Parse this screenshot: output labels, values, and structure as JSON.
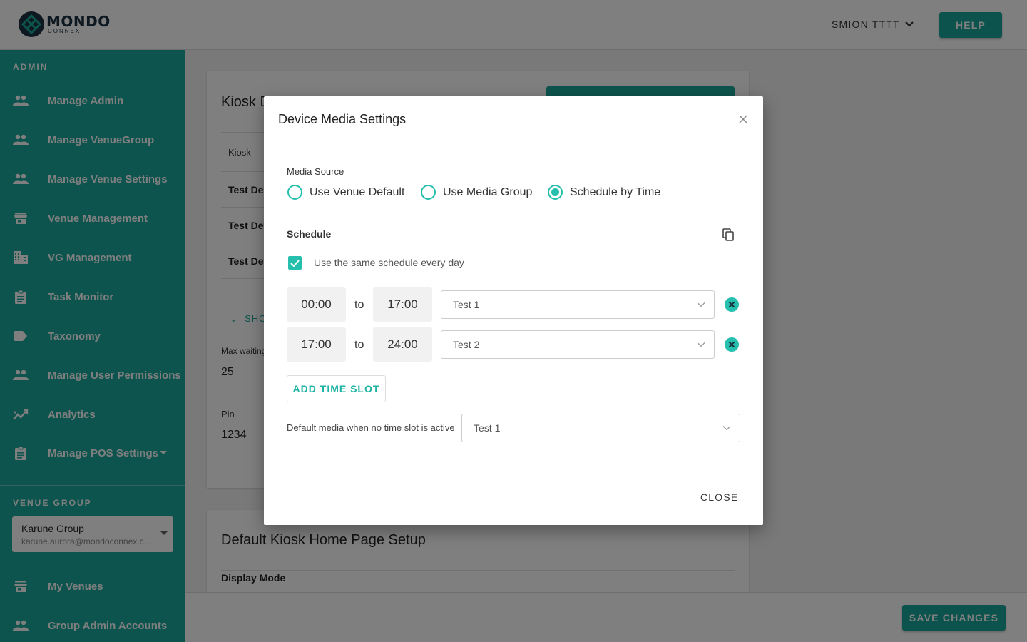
{
  "brand": {
    "name": "MONDO",
    "sub": "CONNEX",
    "accent": "#1aa79a"
  },
  "header": {
    "user_name": "SMION TTTT",
    "help_label": "HELP"
  },
  "sidebar": {
    "admin_title": "ADMIN",
    "items": [
      {
        "label": "Manage Admin",
        "icon": "people-icon"
      },
      {
        "label": "Manage VenueGroup",
        "icon": "people-icon"
      },
      {
        "label": "Manage Venue Settings",
        "icon": "people-icon"
      },
      {
        "label": "Venue Management",
        "icon": "store-icon"
      },
      {
        "label": "VG Management",
        "icon": "building-icon"
      },
      {
        "label": "Task Monitor",
        "icon": "clipboard-icon"
      },
      {
        "label": "Taxonomy",
        "icon": "tag-icon"
      },
      {
        "label": "Manage User Permissions",
        "icon": "people-icon"
      },
      {
        "label": "Analytics",
        "icon": "trending-icon"
      },
      {
        "label": "Manage POS Settings",
        "icon": "clipboard-icon"
      }
    ],
    "venue_group_title": "VENUE GROUP",
    "venue_group": {
      "name": "Karune Group",
      "email": "karune.aurora@mondoconnex.com"
    },
    "bottom_items": [
      {
        "label": "My Venues",
        "icon": "store-icon"
      },
      {
        "label": "Group Admin Accounts",
        "icon": "people-icon"
      }
    ]
  },
  "background": {
    "card_title": "Kiosk D",
    "col_kiosk": "Kiosk",
    "rows": [
      "Test Dev",
      "Test Dev",
      "Test Dev"
    ],
    "show_more": "SHO",
    "max_waiting_label": "Max waiting",
    "max_waiting_value": "25",
    "pin_label": "Pin",
    "pin_value": "1234",
    "home_title": "Default Kiosk Home Page Setup",
    "display_mode_label": "Display Mode",
    "save_label": "SAVE CHANGES"
  },
  "modal": {
    "title": "Device Media Settings",
    "media_source_label": "Media Source",
    "radios": [
      {
        "label": "Use Venue Default",
        "checked": false
      },
      {
        "label": "Use Media Group",
        "checked": false
      },
      {
        "label": "Schedule by Time",
        "checked": true
      }
    ],
    "schedule_label": "Schedule",
    "same_schedule_label": "Use the same schedule every day",
    "same_schedule_checked": true,
    "to_label": "to",
    "slots": [
      {
        "start": "00:00",
        "end": "17:00",
        "media": "Test 1"
      },
      {
        "start": "17:00",
        "end": "24:00",
        "media": "Test 2"
      }
    ],
    "add_slot_label": "ADD TIME SLOT",
    "default_media_label": "Default media when no time slot is active",
    "default_media_value": "Test 1",
    "close_label": "CLOSE"
  }
}
